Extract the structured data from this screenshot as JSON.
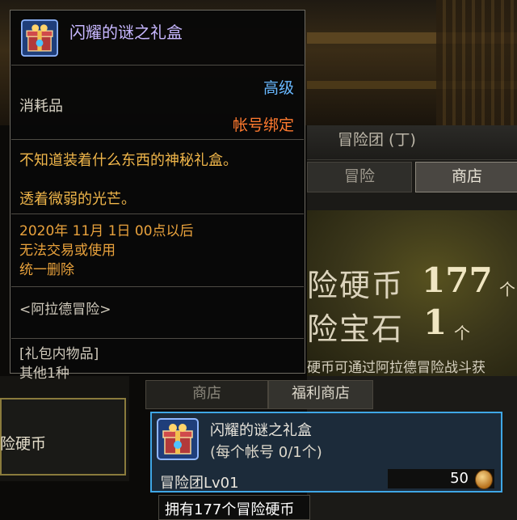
{
  "tooltip": {
    "title": "闪耀的谜之礼盒",
    "grade": "高级",
    "type": "消耗品",
    "bind": "帐号绑定",
    "desc1": "不知道装着什么东西的神秘礼盒。",
    "desc2": "透着微弱的光芒。",
    "expire1": "2020年 11月 1日 00点以后",
    "expire2": "无法交易或使用",
    "expire3": "统一删除",
    "origin": "<阿拉德冒险>",
    "pkg1": "[礼包内物品]",
    "pkg2": "其他1种"
  },
  "window": {
    "title": "冒险团 (丁)",
    "tab_adventure": "冒险",
    "tab_shop": "商店"
  },
  "shop": {
    "coin_label": "险硬币",
    "coin_value": "177",
    "coin_unit": "个",
    "gem_label": "险宝石",
    "gem_value": "1",
    "gem_unit": "个",
    "info": "硬币可通过阿拉德冒险战斗获"
  },
  "subtabs": {
    "shop": "商店",
    "welfare": "福利商店"
  },
  "left": {
    "coin_button": "险硬币"
  },
  "item": {
    "name": "闪耀的谜之礼盒",
    "limit": "(每个帐号 0/1个)",
    "requirement": "冒险团Lv01",
    "price": "50",
    "owned": "拥有177个冒险硬币"
  },
  "colors": {
    "tooltip_title": "#c7b7ff",
    "grade": "#68b8ff",
    "bind": "#ff7a2f",
    "desc": "#f0b64a",
    "item_border": "#3fa7e6"
  },
  "icons": [
    "gift-box-icon",
    "coin-icon"
  ]
}
